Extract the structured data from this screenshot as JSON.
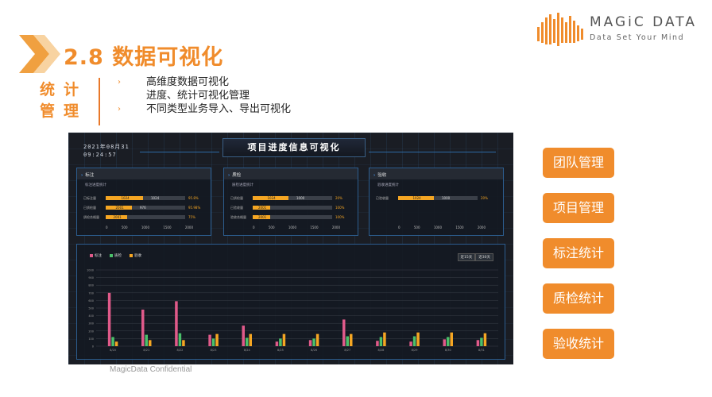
{
  "header": {
    "title": "2.8 数据可视化",
    "logo_main": "MAGiC DATA",
    "logo_sub": "Data Set Your Mind"
  },
  "side_label": [
    "统",
    "计",
    "管",
    "理"
  ],
  "bullets": [
    "高维度数据可视化",
    "进度、统计可视化管理",
    "不同类型业务导入、导出可视化"
  ],
  "dashboard": {
    "date": "2021年08月31",
    "time": "09:24:57",
    "title": "项目进度信息可视化",
    "panels": [
      {
        "name": "标注",
        "subtitle": "标注进度统计",
        "rows": [
          {
            "label": "已标注量",
            "fill": 0.47,
            "a": "1024",
            "b": "1024",
            "pct": "95.8%"
          },
          {
            "label": "已质检量",
            "fill": 0.33,
            "a": "2001",
            "b": "976",
            "pct": "95.98%"
          },
          {
            "label": "质检合格量",
            "fill": 0.27,
            "a": "2001",
            "b": "",
            "pct": "75%"
          }
        ],
        "axis": [
          "0",
          "500",
          "1000",
          "1500",
          "2000"
        ]
      },
      {
        "name": "质检",
        "subtitle": "质检进度统计",
        "rows": [
          {
            "label": "已质检量",
            "fill": 0.45,
            "a": "1024",
            "b": "1000",
            "pct": "20%"
          },
          {
            "label": "已验收量",
            "fill": 0.22,
            "a": "2001",
            "b": "",
            "pct": "100%"
          },
          {
            "label": "验收合格量",
            "fill": 0.22,
            "a": "2001",
            "b": "",
            "pct": "100%"
          }
        ],
        "axis": [
          "0",
          "500",
          "1000",
          "1500",
          "2000"
        ]
      },
      {
        "name": "验收",
        "subtitle": "验收进度统计",
        "rows": [
          {
            "label": "已验收量",
            "fill": 0.45,
            "a": "1024",
            "b": "1000",
            "pct": "20%"
          }
        ],
        "axis": [
          "0",
          "500",
          "1000",
          "1500",
          "2000"
        ]
      }
    ],
    "legend": [
      {
        "name": "标注",
        "color": "#e05a8a"
      },
      {
        "name": "质检",
        "color": "#4ac06a"
      },
      {
        "name": "验收",
        "color": "#f5a623"
      }
    ],
    "ranges": [
      "近15天",
      "近30天"
    ]
  },
  "chart_data": {
    "type": "bar",
    "categories": [
      "8/20",
      "8/21",
      "8/22",
      "8/23",
      "8/24",
      "8/25",
      "8/26",
      "8/27",
      "8/28",
      "8/29",
      "8/30",
      "8/31"
    ],
    "series": [
      {
        "name": "标注",
        "values": [
          700,
          480,
          590,
          150,
          270,
          60,
          80,
          350,
          70,
          60,
          90,
          80
        ]
      },
      {
        "name": "质检",
        "values": [
          120,
          150,
          170,
          100,
          110,
          100,
          100,
          130,
          120,
          130,
          120,
          110
        ]
      },
      {
        "name": "验收",
        "values": [
          60,
          80,
          80,
          160,
          160,
          160,
          160,
          160,
          180,
          180,
          180,
          170
        ]
      }
    ],
    "ylim": [
      0,
      1000
    ],
    "yticks": [
      "0",
      "100",
      "200",
      "300",
      "400",
      "500",
      "600",
      "700",
      "800",
      "900",
      "1000"
    ],
    "colors": [
      "#e05a8a",
      "#4ac06a",
      "#f5a623"
    ]
  },
  "right_buttons": [
    "团队管理",
    "项目管理",
    "标注统计",
    "质检统计",
    "验收统计"
  ],
  "footer": "MagicData Confidential"
}
